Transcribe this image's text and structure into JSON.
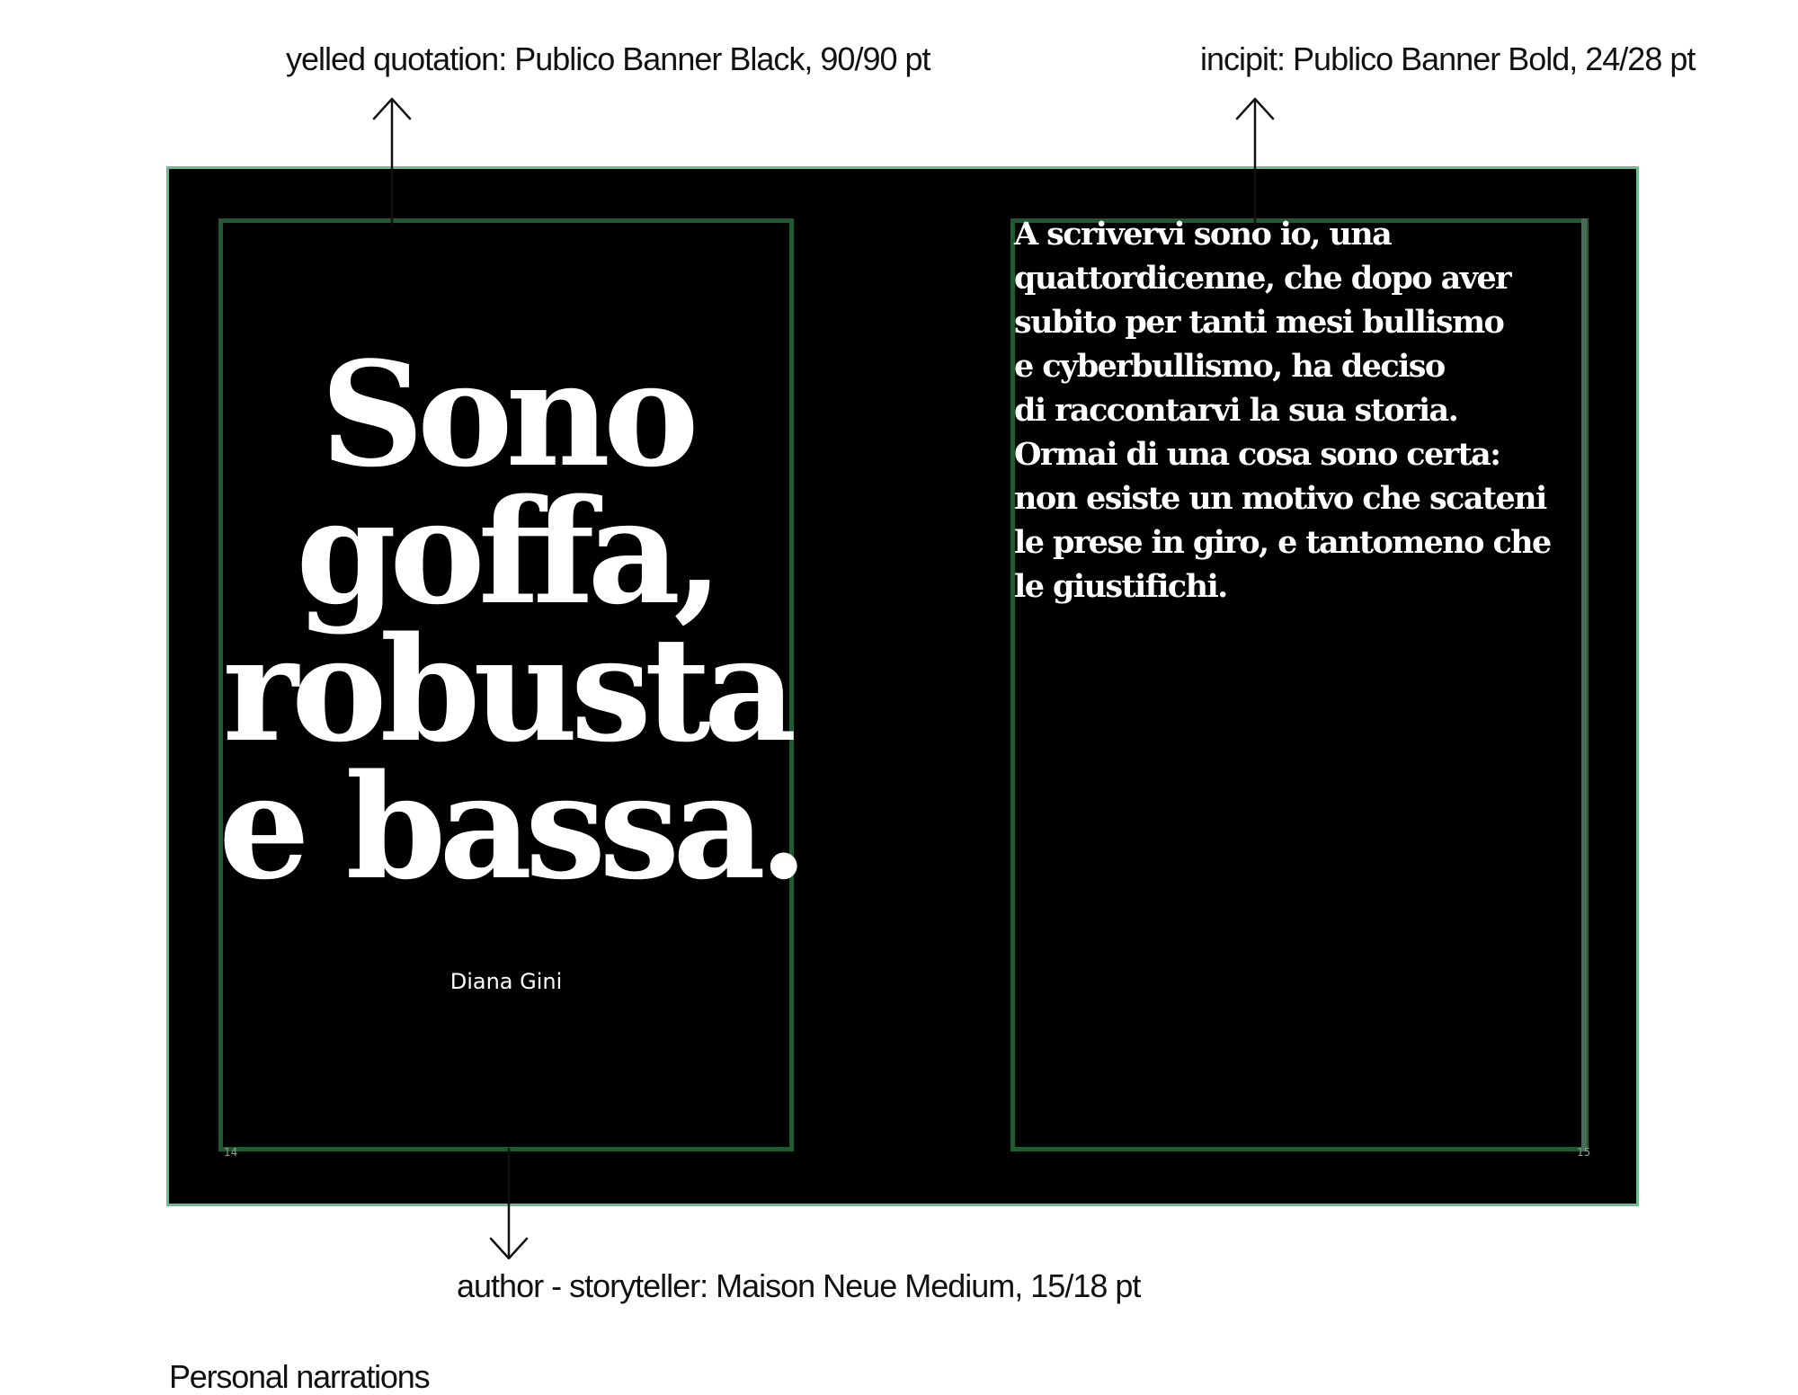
{
  "annotations": {
    "quote_label": "yelled quotation: Publico Banner Black, 90/90 pt",
    "incipit_label": "incipit: Publico Banner Bold, 24/28 pt",
    "author_label": "author - storyteller: Maison Neue Medium, 15/18 pt"
  },
  "caption": "Personal narrations",
  "left_page": {
    "quote_lines": [
      "Sono",
      "goffa,",
      "robusta",
      "e bassa."
    ],
    "author": "Diana Gini",
    "page_number": "14"
  },
  "right_page": {
    "incipit_lines": [
      "A scrivervi sono io, una",
      "quattordicenne, che dopo aver",
      "subito per tanti mesi bullismo",
      "e cyberbullismo, ha deciso",
      "di raccontarvi la sua storia.",
      "Ormai di una cosa sono certa:",
      "non esiste un motivo che scateni",
      "le prese in giro, e tantomeno che",
      "le giustifichi."
    ],
    "page_number": "15"
  },
  "colors": {
    "page_background": "#000000",
    "spread_border": "#6bbf8a",
    "text_frame": "#1f5a30",
    "page_text": "#ffffff"
  }
}
